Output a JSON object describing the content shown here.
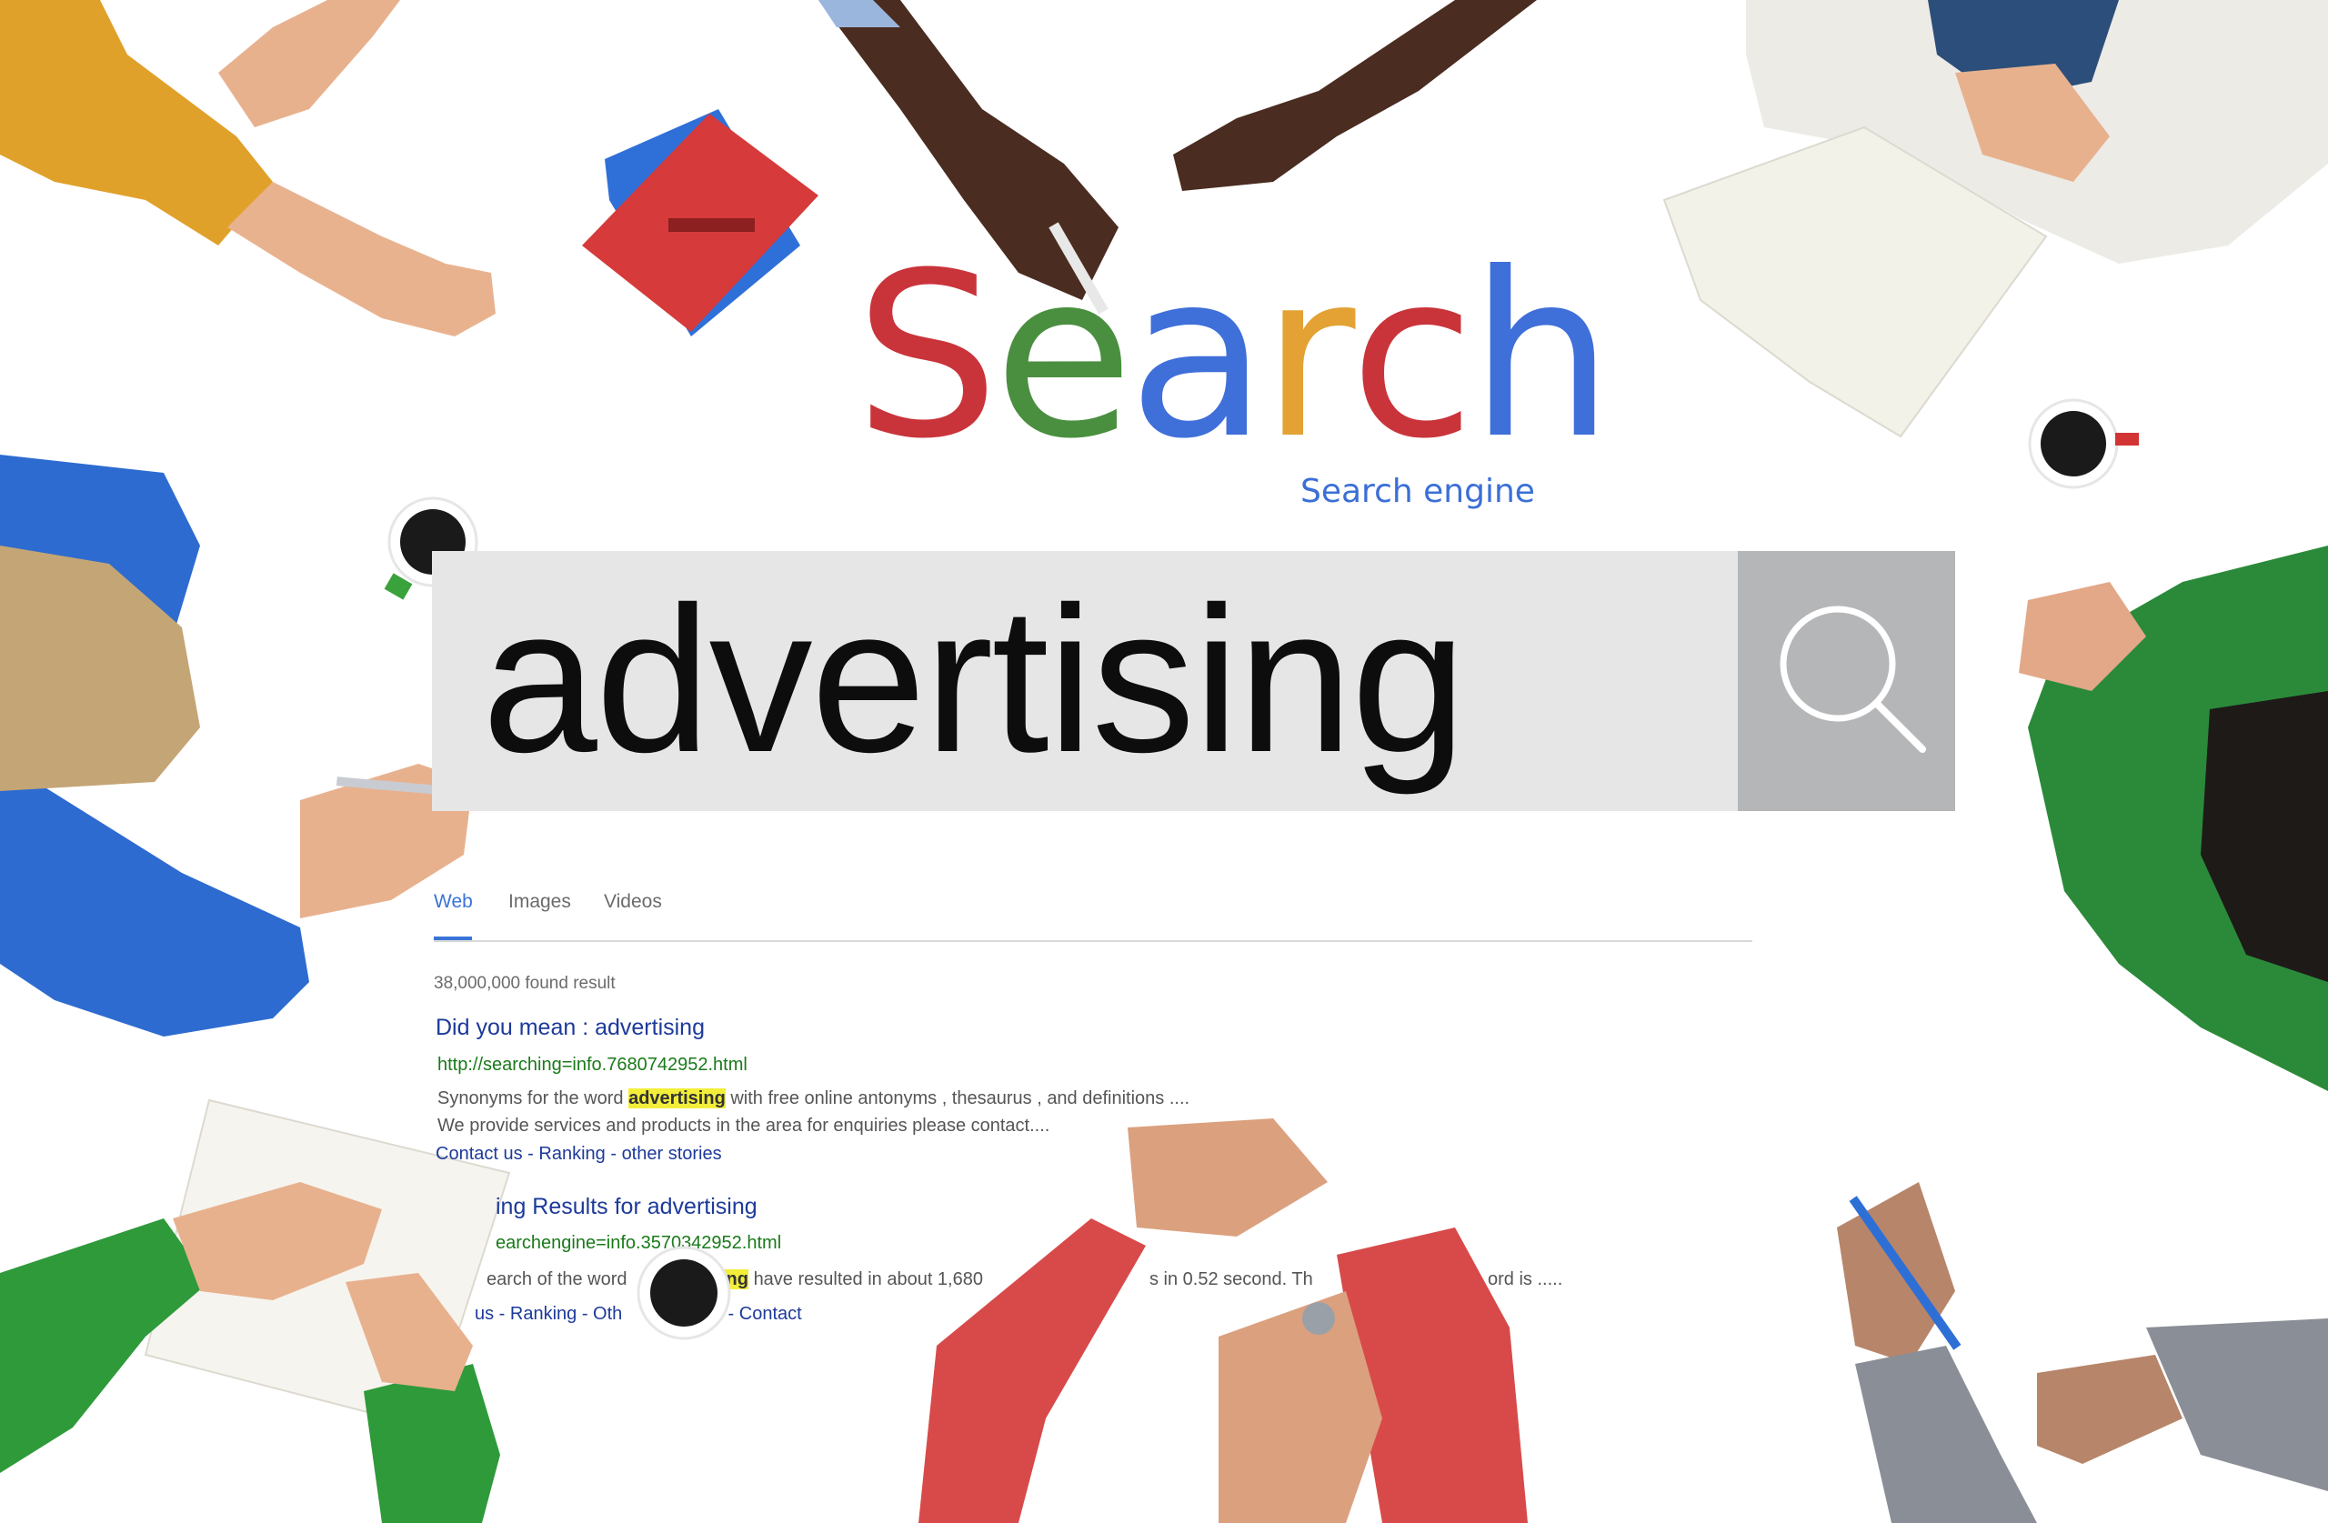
{
  "logo": {
    "letters": [
      {
        "char": "S",
        "color": "#c9343a"
      },
      {
        "char": "e",
        "color": "#4a8f3f"
      },
      {
        "char": "a",
        "color": "#3f6fd9"
      },
      {
        "char": "r",
        "color": "#e3a233"
      },
      {
        "char": "c",
        "color": "#c9343a"
      },
      {
        "char": "h",
        "color": "#3f6fd9"
      }
    ],
    "tagline": "Search engine"
  },
  "search": {
    "query": "advertising",
    "button_icon": "magnifier-icon"
  },
  "tabs": [
    {
      "label": "Web",
      "active": true
    },
    {
      "label": "Images",
      "active": false
    },
    {
      "label": "Videos",
      "active": false
    }
  ],
  "results_count": "38,000,000 found result",
  "results": [
    {
      "title": "Did you mean : advertising",
      "url": "http://searching=info.7680742952.html",
      "desc1_before": "Synonyms for the word ",
      "desc1_highlight": "advertising",
      "desc1_after": " with free online antonyms , thesaurus , and definitions ....",
      "desc2": "We provide services and products in the area for enquiries please contact....",
      "links": [
        "Contact us",
        "Ranking",
        "other stories"
      ]
    },
    {
      "title": "ing Results for advertising",
      "url": "earchengine=info.3570342952.html",
      "desc1_before": "earch of the word",
      "desc1_highlight": "ing",
      "desc1_after": "have resulted in about 1,680",
      "desc1_tail": "s in 0.52 second. Th",
      "desc1_end": "ord is .....",
      "links_before": "us - Ranking - Oth",
      "links_after": "s - Contact"
    }
  ],
  "colors": {
    "accent": "#3a73d8",
    "link": "#1d3a9a",
    "url": "#1a7a1a",
    "highlight": "#f2ee3a",
    "search_box": "#e6e6e6",
    "search_button": "#b4b6b8"
  }
}
